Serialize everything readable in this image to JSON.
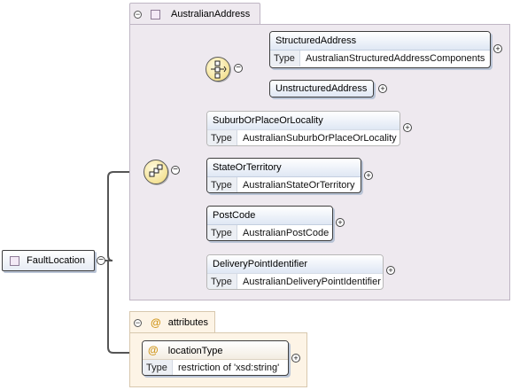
{
  "root": {
    "name": "FaultLocation"
  },
  "group": {
    "name": "AustralianAddress"
  },
  "type_label": "Type",
  "elements": {
    "structured_address": {
      "name": "StructuredAddress",
      "type": "AustralianStructuredAddressComponents"
    },
    "unstructured_address": {
      "name": "UnstructuredAddress"
    },
    "suburb": {
      "name": "SuburbOrPlaceOrLocality",
      "type": "AustralianSuburbOrPlaceOrLocality"
    },
    "state": {
      "name": "StateOrTerritory",
      "type": "AustralianStateOrTerritory"
    },
    "postcode": {
      "name": "PostCode",
      "type": "AustralianPostCode"
    },
    "delivery_point": {
      "name": "DeliveryPointIdentifier",
      "type": "AustralianDeliveryPointIdentifier"
    }
  },
  "attributes": {
    "label": "attributes",
    "at_symbol": "@",
    "location_type": {
      "name": "locationType",
      "type": "restriction of 'xsd:string'"
    }
  },
  "symbols": {
    "collapse": "−",
    "expand": "+"
  },
  "colors": {
    "group_bg": "#eee9ef",
    "attr_bg": "#fdf4e6",
    "line": "#555555",
    "compositor": "#f0d878"
  }
}
